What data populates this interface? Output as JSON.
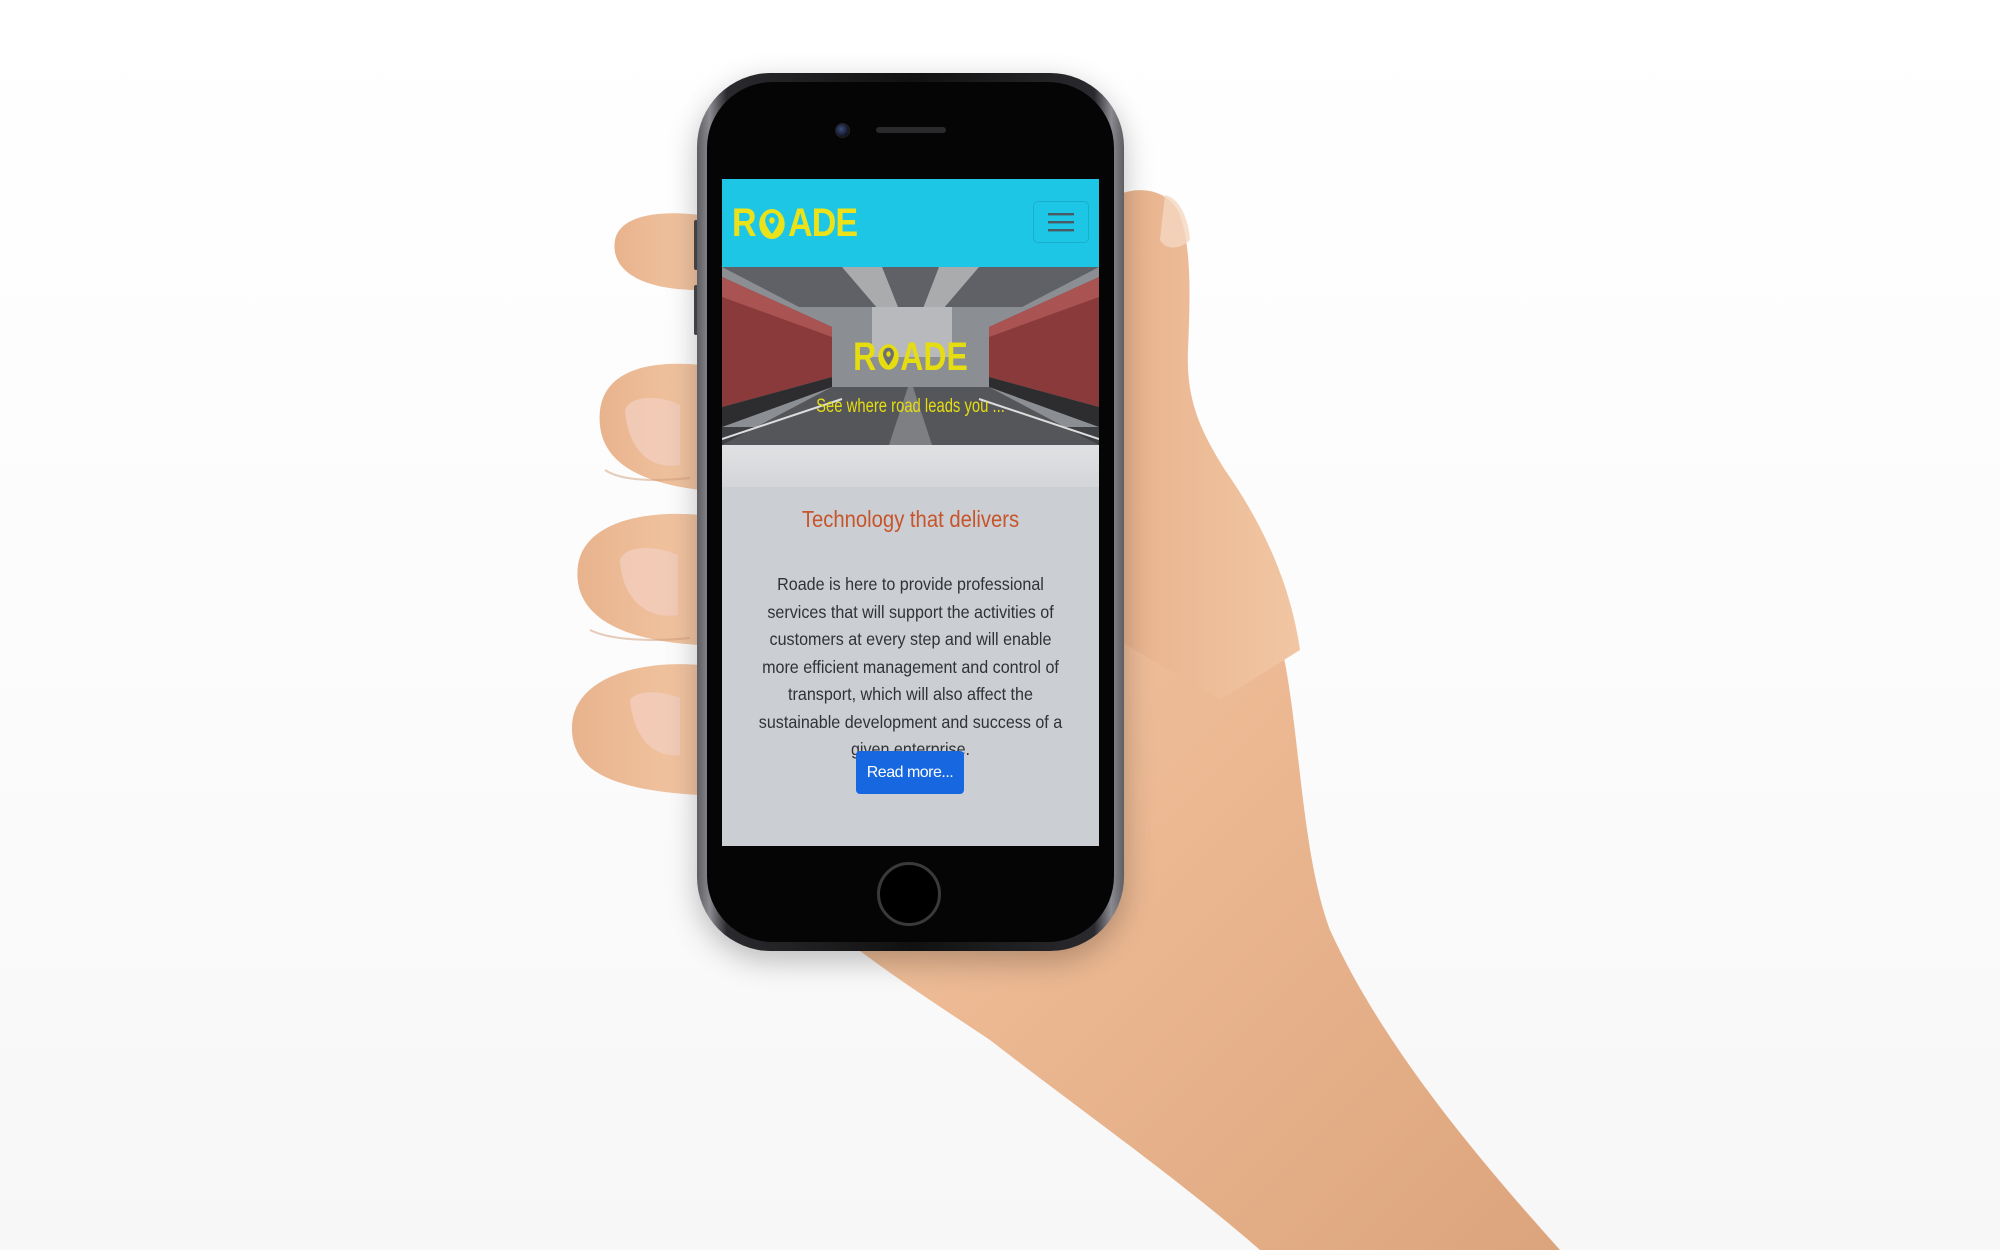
{
  "colors": {
    "navbar": "#1ec6e6",
    "brand": "#ece21a",
    "title": "#c7552c",
    "button": "#1667e0",
    "content_bg": "#cbced2"
  },
  "navbar": {
    "brand": {
      "prefix": "R",
      "suffix": "ADE",
      "pin_icon": "map-pin-icon"
    },
    "menu_icon": "hamburger-menu-icon"
  },
  "hero": {
    "logo": {
      "prefix": "R",
      "suffix": "ADE"
    },
    "tagline": "See where road leads you ..."
  },
  "content": {
    "title": "Technology that delivers",
    "text": "Roade is here to provide professional services that will support the activities of customers at every step and will enable more efficient management and control of transport, which will also affect the sustainable development and success of a given enterprise.",
    "button_label": "Read more..."
  }
}
